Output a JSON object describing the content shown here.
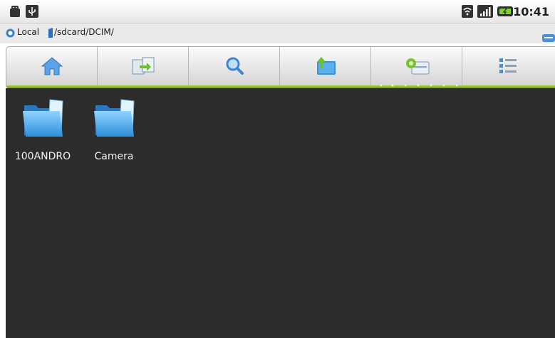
{
  "status_bar": {
    "time": "10:41",
    "icons": [
      "android-icon",
      "usb-icon",
      "wifi-icon",
      "signal-icon",
      "battery-icon"
    ]
  },
  "location_bar": {
    "storage_label": "Local",
    "path": "/sdcard/DCIM/"
  },
  "toolbar": {
    "buttons": [
      "home-icon",
      "copy-icon",
      "search-icon",
      "folder-up-icon",
      "gear-icon",
      "list-view-icon"
    ],
    "accent_color": "#8fc02b"
  },
  "files": [
    {
      "name": "100ANDRO",
      "icon": "folder-icon"
    },
    {
      "name": "Camera",
      "icon": "folder-icon"
    }
  ],
  "colors": {
    "background": "#2c2c2c",
    "folder_blue": "#59b8f0"
  }
}
